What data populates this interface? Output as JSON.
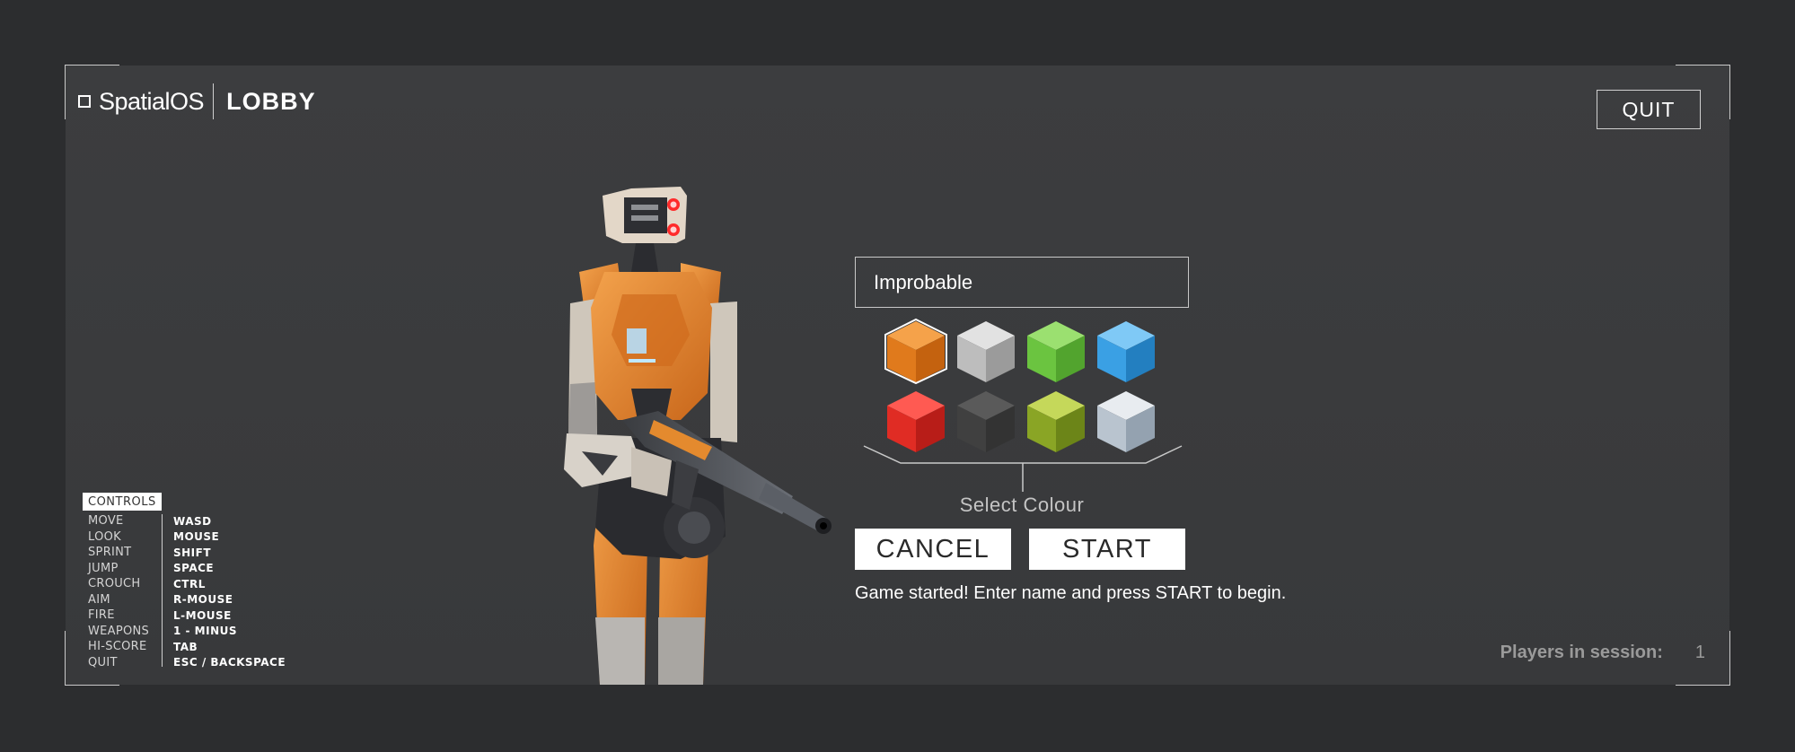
{
  "header": {
    "brand": "SpatialOS",
    "page_title": "LOBBY",
    "quit_label": "QUIT"
  },
  "player_setup": {
    "name_value": "Improbable",
    "colours": [
      {
        "name": "orange",
        "top": "#f5a24a",
        "left": "#e07a1c",
        "right": "#c4620f",
        "selected": true
      },
      {
        "name": "silver",
        "top": "#e2e2e2",
        "left": "#bdbdbd",
        "right": "#9b9b9b",
        "selected": false
      },
      {
        "name": "green",
        "top": "#9be070",
        "left": "#6bc440",
        "right": "#52a42e",
        "selected": false
      },
      {
        "name": "blue",
        "top": "#7fc9f6",
        "left": "#3aa0e4",
        "right": "#237fc0",
        "selected": false
      },
      {
        "name": "red",
        "top": "#ff5a52",
        "left": "#e02c24",
        "right": "#b81d18",
        "selected": false
      },
      {
        "name": "charcoal",
        "top": "#5a5a5a",
        "left": "#404040",
        "right": "#333333",
        "selected": false
      },
      {
        "name": "camo-green",
        "top": "#c5d85a",
        "left": "#8aa525",
        "right": "#6c8518",
        "selected": false
      },
      {
        "name": "camo-ice",
        "top": "#e8ecf0",
        "left": "#b9c4cf",
        "right": "#94a2b0",
        "selected": false
      }
    ],
    "select_colour_label": "Select Colour",
    "cancel_label": "CANCEL",
    "start_label": "START",
    "status_message": "Game started! Enter name and press START to begin."
  },
  "controls": {
    "title": "CONTROLS",
    "items": [
      {
        "action": "MOVE",
        "key": "WASD"
      },
      {
        "action": "LOOK",
        "key": "MOUSE"
      },
      {
        "action": "SPRINT",
        "key": "SHIFT"
      },
      {
        "action": "JUMP",
        "key": "SPACE"
      },
      {
        "action": "CROUCH",
        "key": "CTRL"
      },
      {
        "action": "AIM",
        "key": "R-MOUSE"
      },
      {
        "action": "FIRE",
        "key": "L-MOUSE"
      },
      {
        "action": "WEAPONS",
        "key": "1 - MINUS"
      },
      {
        "action": "HI-SCORE",
        "key": "TAB"
      },
      {
        "action": "QUIT",
        "key": "ESC / BACKSPACE"
      }
    ]
  },
  "session": {
    "players_label": "Players in session:",
    "players_count": "1"
  }
}
